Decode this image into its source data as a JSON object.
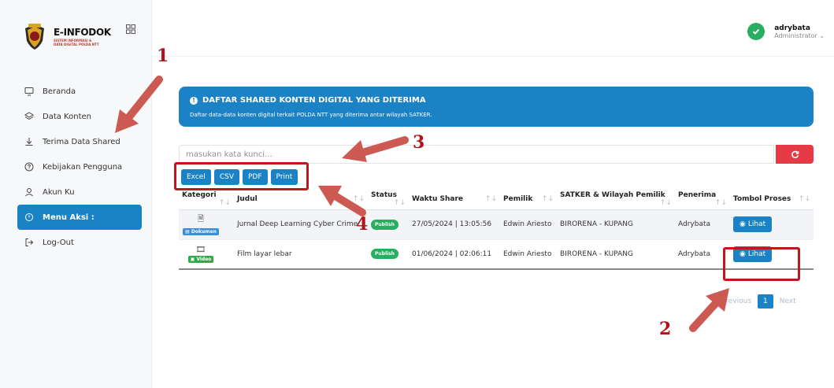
{
  "app": {
    "brand": "E-INFODOK",
    "brand_sub1": "SISTEM INFORMASI &",
    "brand_sub2": "DATA DIGITAL POLDA NTT"
  },
  "sidebar": {
    "items": [
      {
        "label": "Beranda",
        "icon": "monitor-icon"
      },
      {
        "label": "Data Konten",
        "icon": "layers-icon"
      },
      {
        "label": "Terima Data Shared",
        "icon": "download-icon"
      },
      {
        "label": "Kebijakan Pengguna",
        "icon": "help-circle-icon"
      },
      {
        "label": "Akun Ku",
        "icon": "user-icon"
      },
      {
        "label": "Menu Aksi :",
        "icon": "power-icon",
        "active": true
      },
      {
        "label": "Log-Out",
        "icon": "logout-icon"
      }
    ]
  },
  "user": {
    "name": "adrybata",
    "role": "Administrator"
  },
  "banner": {
    "title": "DAFTAR SHARED KONTEN DIGITAL YANG DITERIMA",
    "desc": "Daftar data-data konten digital terkait POLDA NTT yang diterima antar wilayah SATKER."
  },
  "search": {
    "placeholder": "masukan kata kunci..."
  },
  "exports": [
    "Excel",
    "CSV",
    "PDF",
    "Print"
  ],
  "table": {
    "headers": [
      "Kategori",
      "Judul",
      "Status",
      "Waktu Share",
      "Pemilik",
      "SATKER & Wilayah Pemilik",
      "Penerima",
      "Tombol Proses"
    ],
    "rows": [
      {
        "category": "Dokumen",
        "category_icon": "document-icon",
        "category_color": "#3a8fd9",
        "title": "Jurnal Deep Learning Cyber Crime",
        "status": "Publish",
        "time": "27/05/2024 | 13:05:56",
        "owner": "Edwin Ariesto",
        "satker": "BIRORENA - KUPANG",
        "receiver": "Adrybata",
        "action": "Lihat"
      },
      {
        "category": "Video",
        "category_icon": "film-icon",
        "category_color": "#2eaa4a",
        "title": "Film layar lebar",
        "status": "Publish",
        "time": "01/06/2024 | 02:06:11",
        "owner": "Edwin Ariesto",
        "satker": "BIRORENA - KUPANG",
        "receiver": "Adrybata",
        "action": "Lihat"
      }
    ]
  },
  "pagination": {
    "previous": "Previous",
    "current": "1",
    "next": "Next"
  },
  "annotations": {
    "n1": "1",
    "n2": "2",
    "n3": "3",
    "n4": "4"
  },
  "colors": {
    "accent": "#1b82c6",
    "highlight": "#c0161d",
    "arrow": "#cc5a52",
    "danger": "#e63946",
    "success": "#27ae60"
  }
}
